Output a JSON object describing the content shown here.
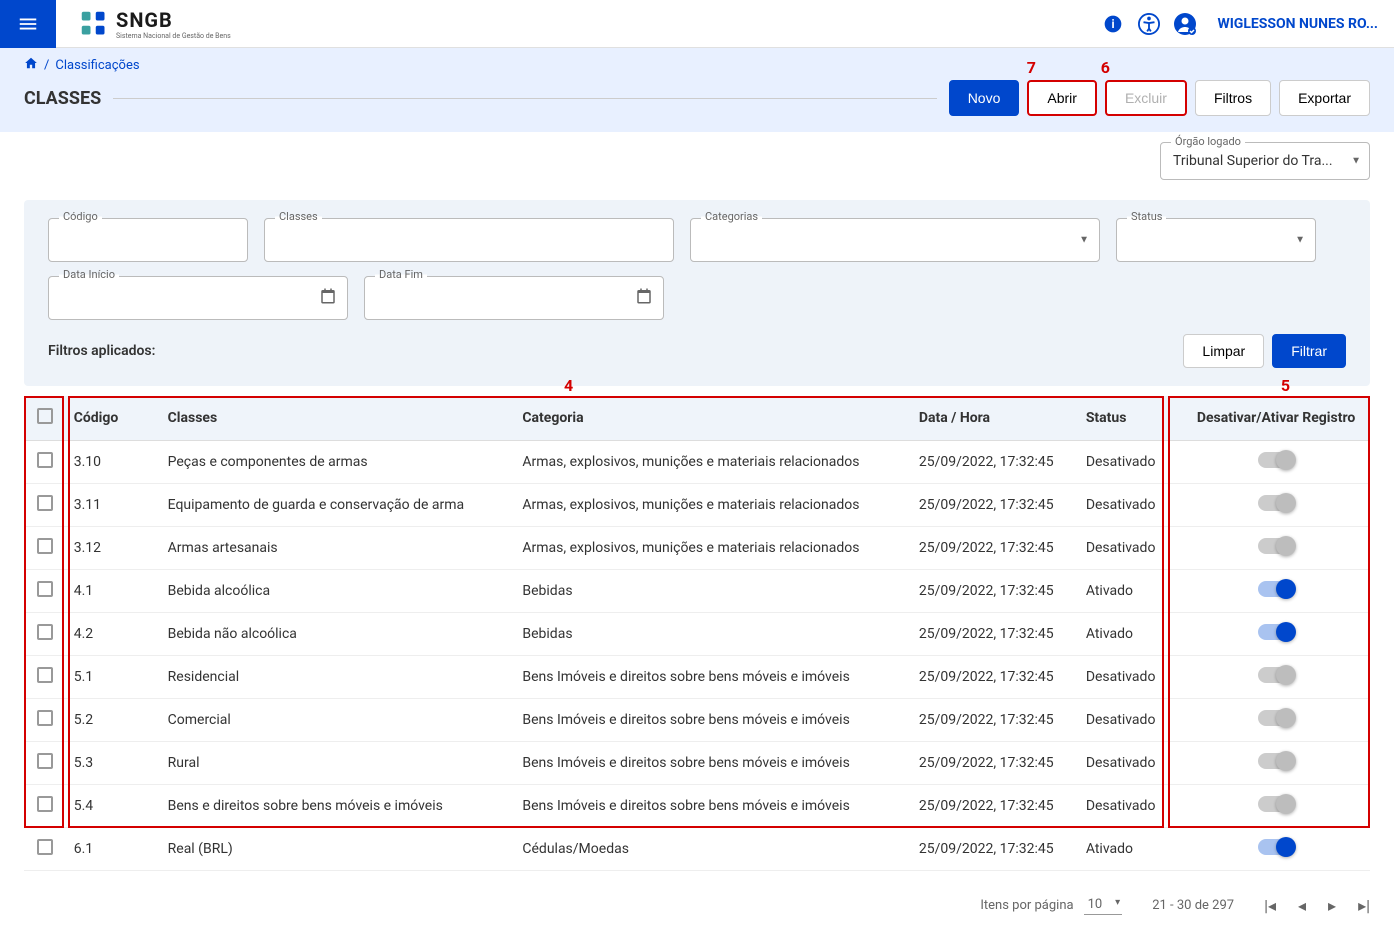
{
  "header": {
    "logo_title": "SNGB",
    "logo_subtitle": "Sistema Nacional de Gestão de Bens",
    "user_name": "WIGLESSON NUNES RO..."
  },
  "breadcrumb": {
    "home_icon": "home",
    "item": "Classificações"
  },
  "page_title": "CLASSES",
  "actions": {
    "novo": "Novo",
    "abrir": "Abrir",
    "excluir": "Excluir",
    "filtros": "Filtros",
    "exportar": "Exportar"
  },
  "annotations": {
    "a4": "4",
    "a5": "5",
    "a6": "6",
    "a7": "7"
  },
  "orgao": {
    "label": "Órgão logado",
    "value": "Tribunal Superior do Tra..."
  },
  "filters": {
    "codigo": "Código",
    "classes": "Classes",
    "categorias": "Categorias",
    "status": "Status",
    "data_inicio": "Data Início",
    "data_fim": "Data Fim",
    "aplicados": "Filtros aplicados:",
    "limpar": "Limpar",
    "filtrar": "Filtrar"
  },
  "table": {
    "headers": {
      "codigo": "Código",
      "classes": "Classes",
      "categoria": "Categoria",
      "data_hora": "Data / Hora",
      "status": "Status",
      "toggle": "Desativar/Ativar Registro"
    },
    "rows": [
      {
        "codigo": "3.10",
        "classe": "Peças e componentes de armas",
        "categoria": "Armas, explosivos, munições e materiais relacionados",
        "data": "25/09/2022, 17:32:45",
        "status": "Desativado",
        "on": false
      },
      {
        "codigo": "3.11",
        "classe": "Equipamento de guarda e conservação de arma",
        "categoria": "Armas, explosivos, munições e materiais relacionados",
        "data": "25/09/2022, 17:32:45",
        "status": "Desativado",
        "on": false
      },
      {
        "codigo": "3.12",
        "classe": "Armas artesanais",
        "categoria": "Armas, explosivos, munições e materiais relacionados",
        "data": "25/09/2022, 17:32:45",
        "status": "Desativado",
        "on": false
      },
      {
        "codigo": "4.1",
        "classe": "Bebida alcoólica",
        "categoria": "Bebidas",
        "data": "25/09/2022, 17:32:45",
        "status": "Ativado",
        "on": true
      },
      {
        "codigo": "4.2",
        "classe": "Bebida não alcoólica",
        "categoria": "Bebidas",
        "data": "25/09/2022, 17:32:45",
        "status": "Ativado",
        "on": true
      },
      {
        "codigo": "5.1",
        "classe": "Residencial",
        "categoria": "Bens Imóveis e direitos sobre bens móveis e imóveis",
        "data": "25/09/2022, 17:32:45",
        "status": "Desativado",
        "on": false
      },
      {
        "codigo": "5.2",
        "classe": "Comercial",
        "categoria": "Bens Imóveis e direitos sobre bens móveis e imóveis",
        "data": "25/09/2022, 17:32:45",
        "status": "Desativado",
        "on": false
      },
      {
        "codigo": "5.3",
        "classe": "Rural",
        "categoria": "Bens Imóveis e direitos sobre bens móveis e imóveis",
        "data": "25/09/2022, 17:32:45",
        "status": "Desativado",
        "on": false
      },
      {
        "codigo": "5.4",
        "classe": "Bens e direitos sobre bens móveis e imóveis",
        "categoria": "Bens Imóveis e direitos sobre bens móveis e imóveis",
        "data": "25/09/2022, 17:32:45",
        "status": "Desativado",
        "on": false
      },
      {
        "codigo": "6.1",
        "classe": "Real (BRL)",
        "categoria": "Cédulas/Moedas",
        "data": "25/09/2022, 17:32:45",
        "status": "Ativado",
        "on": true
      }
    ]
  },
  "pagination": {
    "items_label": "Itens por página",
    "items_value": "10",
    "range": "21 - 30 de 297"
  }
}
